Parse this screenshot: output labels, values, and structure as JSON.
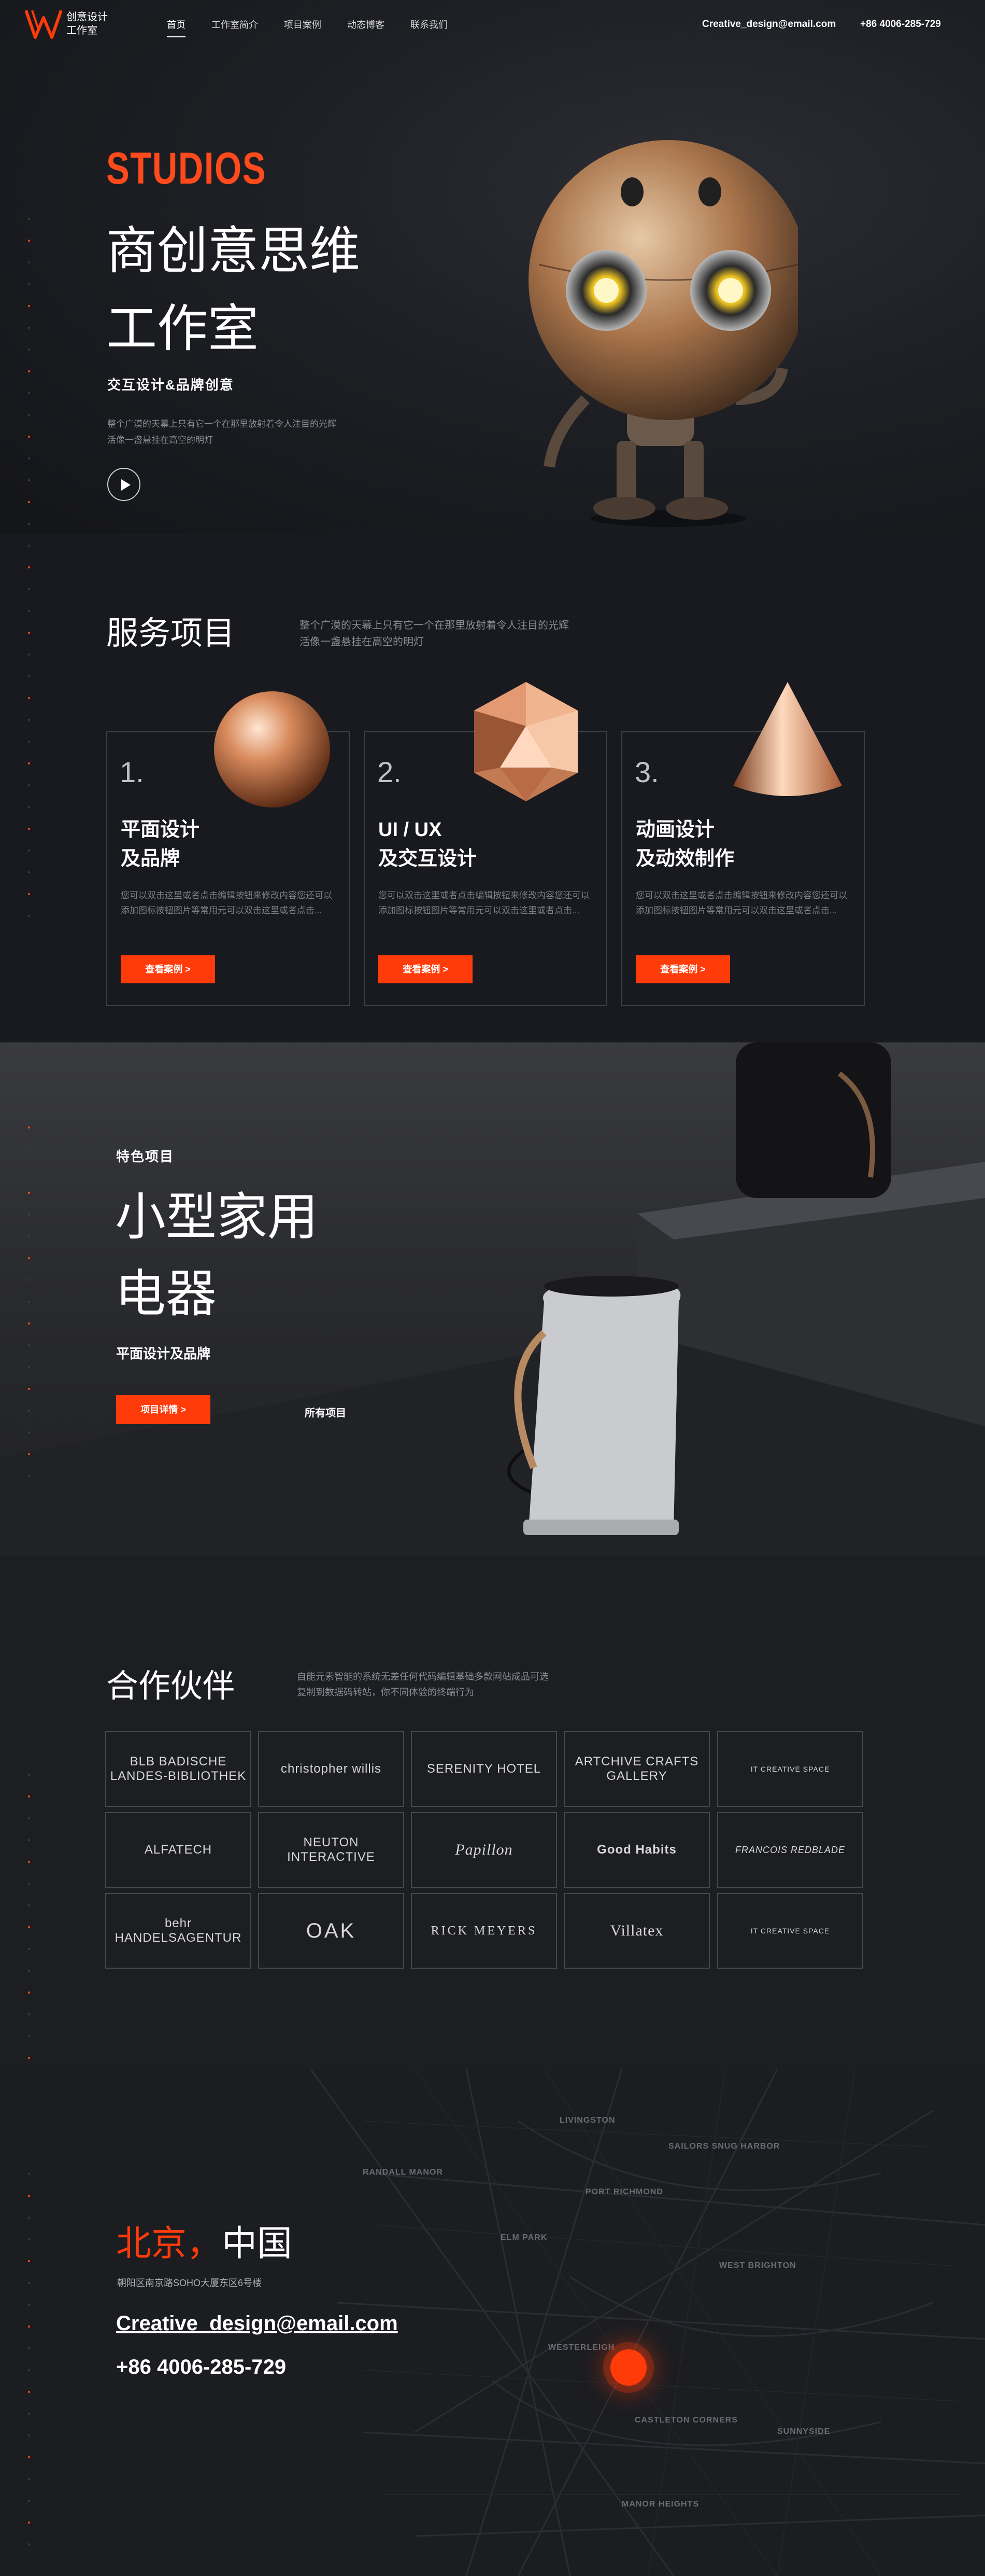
{
  "header": {
    "logo_line1": "创意设计",
    "logo_line2": "工作室",
    "nav": [
      "首页",
      "工作室简介",
      "项目案例",
      "动态博客",
      "联系我们"
    ],
    "email": "Creative_design@email.com",
    "phone": "+86 4006-285-729"
  },
  "hero": {
    "eyebrow": "STUDIOS",
    "title_line1": "商创意思维",
    "title_line2": "工作室",
    "subtitle": "交互设计&品牌创意",
    "desc_line1": "整个广漠的天幕上只有它一个在那里放射着令人注目的光辉",
    "desc_line2": "活像一盏悬挂在高空的明灯",
    "play_icon": "play-icon"
  },
  "services": {
    "title": "服务项目",
    "desc_line1": "整个广漠的天幕上只有它一个在那里放射着令人注目的光辉",
    "desc_line2": "活像一盏悬挂在高空的明灯",
    "cards": [
      {
        "num": "1.",
        "title1": "平面设计",
        "title2": "及品牌",
        "text": "您可以双击这里或者点击编辑按钮来修改内容您还可以添加图标按钮图片等常用元可以双击这里或者点击...",
        "button": "查看案例 >",
        "shape": "copper-sphere"
      },
      {
        "num": "2.",
        "title1": "UI / UX",
        "title2": "及交互设计",
        "text": "您可以双击这里或者点击编辑按钮来修改内容您还可以添加图标按钮图片等常用元可以双击这里或者点击...",
        "button": "查看案例 >",
        "shape": "copper-icosahedron"
      },
      {
        "num": "3.",
        "title1": "动画设计",
        "title2": "及动效制作",
        "text": "您可以双击这里或者点击编辑按钮来修改内容您还可以添加图标按钮图片等常用元可以双击这里或者点击...",
        "button": "查看案例 >",
        "shape": "copper-cone"
      }
    ],
    "accent": "#ff3b0a"
  },
  "featured": {
    "eyebrow": "特色项目",
    "title_line1": "小型家用",
    "title_line2": "电器",
    "subtitle": "平面设计及品牌",
    "button": "项目详情 >",
    "all_link": "所有项目"
  },
  "partners": {
    "title": "合作伙伴",
    "desc_line1": "自能元素智能的系统无差任何代码编辑基础多款网站成品可选",
    "desc_line2": "复制到数据码转站，你不同体验的终端行为",
    "logos": [
      "BLB BADISCHE LANDES-BIBLIOTHEK",
      "christopher willis",
      "SERENITY HOTEL",
      "ARTCHIVE CRAFTS GALLERY",
      "IT CREATIVE SPACE",
      "ALFATECH",
      "NEUTON INTERACTIVE",
      "Papillon",
      "Good Habits",
      "FRANCOIS REDBLADE",
      "behr HANDELSAGENTUR",
      "OAK",
      "RICK MEYERS",
      "Villatex",
      "IT CREATIVE SPACE"
    ]
  },
  "contact": {
    "city_a": "北京，",
    "city_b": "中国",
    "address": "朝阳区南京路SOHO大厦东区6号楼",
    "email": "Creative_design@email.com",
    "phone": "+86 4006-285-729",
    "map_labels": [
      "PORT RICHMOND",
      "ELM PARK",
      "WEST BRIGHTON",
      "WESTERLEIGH",
      "CASTLETON CORNERS",
      "SUNNYSIDE",
      "MANOR HEIGHTS",
      "RANDALL MANOR",
      "LIVINGSTON",
      "SAILORS SNUG HARBOR"
    ]
  }
}
